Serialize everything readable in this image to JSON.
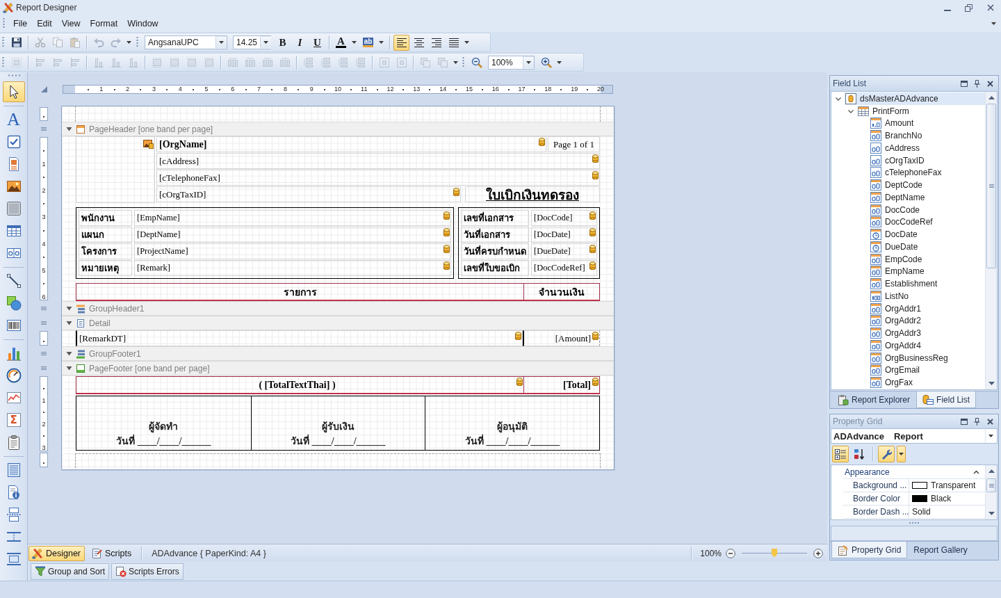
{
  "window": {
    "title": "Report Designer"
  },
  "menu": [
    {
      "label": "File"
    },
    {
      "label": "Edit"
    },
    {
      "label": "View"
    },
    {
      "label": "Format"
    },
    {
      "label": "Window"
    }
  ],
  "main_toolbar": {
    "file_buttons": [
      {
        "disabled": false
      }
    ],
    "edit_buttons": [
      {
        "disabled": true
      },
      {
        "disabled": true
      },
      {
        "disabled": true
      }
    ],
    "history_buttons": [
      {
        "disabled": true
      },
      {
        "disabled": true
      }
    ],
    "font": "AngsanaUPC",
    "font_size": "14.25",
    "style_buttons": [
      {
        "glyph": "B",
        "selected": false
      },
      {
        "glyph": "I",
        "selected": false
      },
      {
        "glyph": "U",
        "selected": false
      }
    ],
    "font_color": {
      "glyph": "A"
    },
    "highlight": {
      "glyph": "ab"
    },
    "alignment": [
      {
        "selected": true
      },
      {
        "selected": false
      },
      {
        "selected": false
      },
      {
        "selected": false
      }
    ]
  },
  "layout_toolbar": {
    "groups": [
      {
        "buttons": [
          {
            "disabled": true
          }
        ]
      },
      {
        "buttons": [
          {
            "disabled": true
          },
          {
            "disabled": true
          },
          {
            "disabled": true
          }
        ]
      },
      {
        "buttons": [
          {
            "disabled": true
          },
          {
            "disabled": true
          },
          {
            "disabled": true
          }
        ]
      },
      {
        "buttons": [
          {
            "disabled": true
          },
          {
            "disabled": true
          },
          {
            "disabled": true
          },
          {
            "disabled": true
          }
        ]
      },
      {
        "buttons": [
          {
            "disabled": true
          },
          {
            "disabled": true
          },
          {
            "disabled": true
          },
          {
            "disabled": true
          }
        ]
      },
      {
        "buttons": [
          {
            "disabled": true
          },
          {
            "disabled": true
          },
          {
            "disabled": true
          },
          {
            "disabled": true
          }
        ]
      },
      {
        "buttons": [
          {
            "disabled": true
          },
          {
            "disabled": true
          }
        ]
      },
      {
        "buttons": [
          {
            "disabled": true
          },
          {
            "disabled": true
          }
        ]
      }
    ],
    "zoom": "100%"
  },
  "toolbox": {
    "groups": [
      {
        "tools": [
          {
            "selected": true
          }
        ]
      },
      {
        "tools": [
          {
            "glyph": "A",
            "selected": false
          },
          {
            "selected": false
          },
          {
            "selected": false
          },
          {
            "selected": false
          },
          {
            "selected": false
          },
          {
            "selected": false
          },
          {
            "selected": false
          }
        ]
      },
      {
        "tools": [
          {
            "selected": false
          },
          {
            "selected": false
          },
          {
            "selected": false
          }
        ]
      },
      {
        "tools": [
          {
            "selected": false
          },
          {
            "selected": false
          },
          {
            "selected": false
          },
          {
            "glyph": "Σ",
            "selected": false
          },
          {
            "selected": false
          }
        ]
      },
      {
        "tools": [
          {
            "selected": false
          },
          {
            "selected": false
          },
          {
            "selected": false
          },
          {
            "selected": false
          },
          {
            "selected": false
          }
        ]
      }
    ]
  },
  "ruler": {
    "marks": [
      "1",
      "2",
      "3",
      "4",
      "5",
      "6",
      "7",
      "8",
      "9",
      "10",
      "11",
      "12",
      "13",
      "14",
      "15",
      "16",
      "17",
      "18",
      "19",
      "20"
    ]
  },
  "report": {
    "bands": [
      {
        "kind": "page-header",
        "title": "PageHeader [one band per page]",
        "expanded": true,
        "ruler_marks": [
          "1",
          "2",
          "3",
          "4",
          "5",
          "6"
        ],
        "org_name": "[OrgName]",
        "page_info": "Page 1 of 1",
        "lines": [
          "[cAddress]",
          "[cTelephoneFax]"
        ],
        "tax_id": "[cOrgTaxID]",
        "doc_title": "ใบเบิกเงินทดรอง",
        "left_fields": [
          {
            "label": "พนักงาน",
            "value": "[EmpName]"
          },
          {
            "label": "แผนก",
            "value": "[DeptName]"
          },
          {
            "label": "โครงการ",
            "value": "[ProjectName]"
          },
          {
            "label": "หมายเหตุ",
            "value": "[Remark]"
          }
        ],
        "right_fields": [
          {
            "label": "เลขที่เอกสาร",
            "value": "[DocCode]"
          },
          {
            "label": "วันที่เอกสาร",
            "value": "[DocDate]"
          },
          {
            "label": "วันที่ครบกำหนด",
            "value": "[DueDate]"
          },
          {
            "label": "เลขที่ใบขอเบิก",
            "value": "[DocCodeRef]"
          }
        ],
        "columns": [
          "รายการ",
          "จำนวนเงิน"
        ]
      },
      {
        "kind": "group-header",
        "title": "GroupHeader1",
        "expanded": true
      },
      {
        "kind": "detail",
        "title": "Detail",
        "expanded": true,
        "cells": [
          "[RemarkDT]",
          "[Amount]"
        ]
      },
      {
        "kind": "group-footer",
        "title": "GroupFooter1",
        "expanded": true
      },
      {
        "kind": "page-footer",
        "title": "PageFooter [one band per page]",
        "expanded": true,
        "ruler_marks": [
          "1",
          "2",
          "3"
        ],
        "totals": [
          "( [TotalTextThai] )",
          "[Total]"
        ],
        "signatures": [
          {
            "role": "ผู้จัดทำ",
            "date": "วันที่ ____/____/______"
          },
          {
            "role": "ผู้รับเงิน",
            "date": "วันที่ ____/____/______"
          },
          {
            "role": "ผู้อนุมัติ",
            "date": "วันที่ ____/____/______"
          }
        ]
      }
    ]
  },
  "field_list": {
    "title": "Field List",
    "tree": [
      {
        "label": "dsMasterADAdvance",
        "kind": "dataset",
        "expanded": true,
        "selected": true,
        "children": [
          {
            "label": "PrintForm",
            "kind": "table",
            "expanded": true,
            "selected": false,
            "children": [
              {
                "label": "Amount",
                "kind": "decimal",
                "selected": false
              },
              {
                "label": "BranchNo",
                "kind": "string",
                "selected": false
              },
              {
                "label": "cAddress",
                "kind": "text",
                "selected": false
              },
              {
                "label": "cOrgTaxID",
                "kind": "text",
                "selected": false
              },
              {
                "label": "cTelephoneFax",
                "kind": "text",
                "selected": false
              },
              {
                "label": "DeptCode",
                "kind": "string",
                "selected": false
              },
              {
                "label": "DeptName",
                "kind": "string",
                "selected": false
              },
              {
                "label": "DocCode",
                "kind": "string",
                "selected": false
              },
              {
                "label": "DocCodeRef",
                "kind": "string",
                "selected": false
              },
              {
                "label": "DocDate",
                "kind": "date",
                "selected": false
              },
              {
                "label": "DueDate",
                "kind": "date",
                "selected": false
              },
              {
                "label": "EmpCode",
                "kind": "string",
                "selected": false
              },
              {
                "label": "EmpName",
                "kind": "string",
                "selected": false
              },
              {
                "label": "Establishment",
                "kind": "string",
                "selected": false
              },
              {
                "label": "ListNo",
                "kind": "integer",
                "selected": false
              },
              {
                "label": "OrgAddr1",
                "kind": "string",
                "selected": false
              },
              {
                "label": "OrgAddr2",
                "kind": "string",
                "selected": false
              },
              {
                "label": "OrgAddr3",
                "kind": "string",
                "selected": false
              },
              {
                "label": "OrgAddr4",
                "kind": "string",
                "selected": false
              },
              {
                "label": "OrgBusinessReg",
                "kind": "string",
                "selected": false
              },
              {
                "label": "OrgEmail",
                "kind": "string",
                "selected": false
              },
              {
                "label": "OrgFax",
                "kind": "string",
                "selected": false
              }
            ]
          }
        ]
      }
    ],
    "tabs": [
      {
        "label": "Report Explorer",
        "selected": false
      },
      {
        "label": "Field List",
        "selected": true
      }
    ]
  },
  "property_grid": {
    "title": "Property Grid",
    "object": {
      "name": "ADAdvance",
      "type": "Report"
    },
    "tool_buttons": [
      {
        "selected": true
      },
      {
        "selected": false
      },
      {
        "selected": true
      },
      {
        "selected": true
      }
    ],
    "categories": [
      {
        "label": "Appearance",
        "expanded": true,
        "properties": [
          {
            "name": "Background ...",
            "value": "Transparent",
            "color": "#ffffff"
          },
          {
            "name": "Border Color",
            "value": "Black",
            "color": "#000000"
          },
          {
            "name": "Border Dash ...",
            "value": "Solid"
          }
        ]
      }
    ],
    "tabs": [
      {
        "label": "Property Grid",
        "selected": true
      },
      {
        "label": "Report Gallery",
        "selected": false
      }
    ]
  },
  "status_bar": {
    "views": [
      {
        "label": "Designer",
        "selected": true
      },
      {
        "label": "Scripts",
        "selected": false
      }
    ],
    "document": "ADAdvance { PaperKind: A4 }",
    "zoom": "100%",
    "zoom_slider": {
      "level": 0.5
    }
  },
  "bottom_tabs": [
    {
      "label": "Group and Sort"
    },
    {
      "label": "Scripts Errors"
    }
  ]
}
